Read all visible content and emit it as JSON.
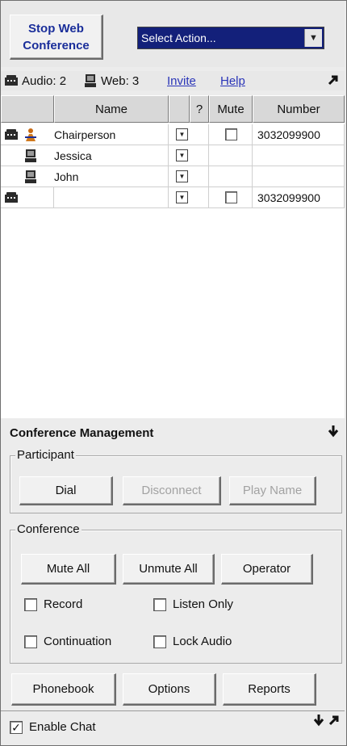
{
  "toolbar": {
    "stop_line1": "Stop Web",
    "stop_line2": "Conference",
    "action_select": {
      "value": "Select Action...",
      "arrow_icon": "dropdown-arrow-icon"
    }
  },
  "status": {
    "audio_label": "Audio: 2",
    "web_label": "Web: 3",
    "invite_link": "Invite",
    "help_link": "Help",
    "popout_icon": "popout-arrow-icon"
  },
  "table": {
    "headers": {
      "name": "Name",
      "q": "?",
      "mute": "Mute",
      "number": "Number"
    },
    "rows": [
      {
        "phone": true,
        "role_icon": "chairperson-icon",
        "name": "Chairperson",
        "mute": true,
        "number": "3032099900"
      },
      {
        "phone": false,
        "role_icon": "computer-icon",
        "name": "Jessica",
        "mute": false,
        "number": ""
      },
      {
        "phone": false,
        "role_icon": "computer-icon",
        "name": "John",
        "mute": false,
        "number": ""
      },
      {
        "phone": true,
        "role_icon": "",
        "name": "",
        "mute": true,
        "number": "3032099900"
      }
    ]
  },
  "management": {
    "title": "Conference Management",
    "collapse_icon": "pin-icon",
    "participant_group": "Participant",
    "dial": "Dial",
    "disconnect": "Disconnect",
    "play_name": "Play Name",
    "conference_group": "Conference",
    "mute_all": "Mute All",
    "unmute_all": "Unmute All",
    "operator": "Operator",
    "record": "Record",
    "listen_only": "Listen Only",
    "continuation": "Continuation",
    "lock_audio": "Lock Audio"
  },
  "footer": {
    "phonebook": "Phonebook",
    "options": "Options",
    "reports": "Reports",
    "enable_chat": "Enable Chat",
    "enable_chat_checked": true
  },
  "colors": {
    "accent_text": "#1a2e9a",
    "select_bg": "#13207a",
    "link": "#2a35b8"
  }
}
